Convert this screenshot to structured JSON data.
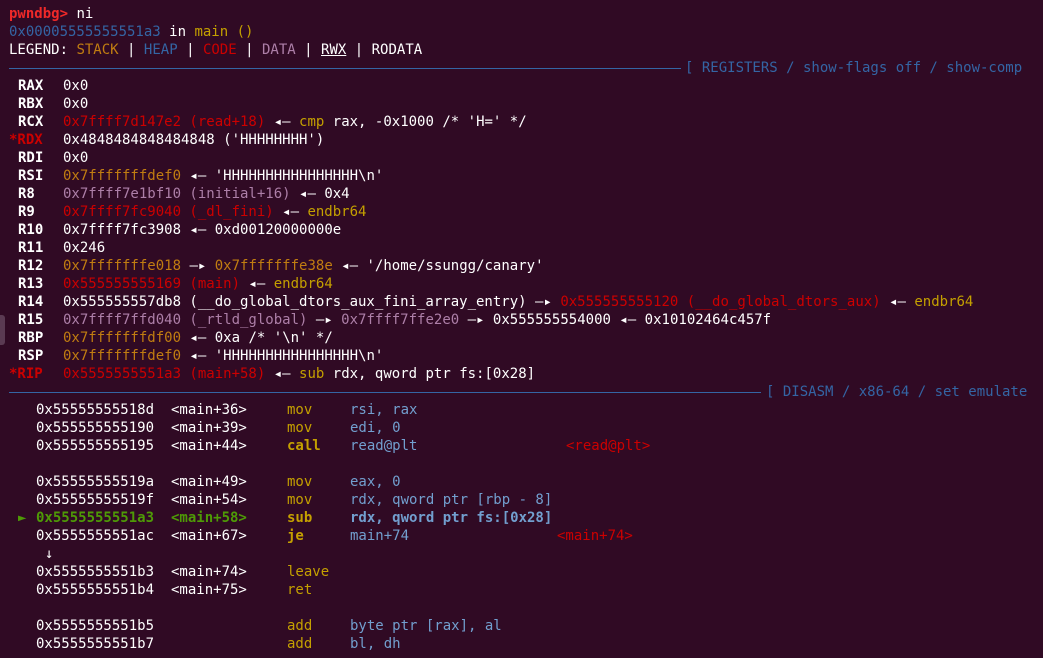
{
  "prompt": {
    "text": "pwndbg>",
    "command": "ni"
  },
  "location": {
    "address": "0x00005555555551a3",
    "in_word": "in",
    "func": "main ()"
  },
  "legend": {
    "label": "LEGEND:",
    "items": [
      "STACK",
      "HEAP",
      "CODE",
      "DATA",
      "RWX",
      "RODATA"
    ],
    "sep": "|"
  },
  "sections": {
    "registers": "[ REGISTERS / show-flags off / show-comp",
    "disasm": "[ DISASM / x86-64 / set emulate"
  },
  "registers": {
    "rax": {
      "name": "RAX",
      "value": "0x0"
    },
    "rbx": {
      "name": "RBX",
      "value": "0x0"
    },
    "rcx": {
      "name": "RCX",
      "value": "0x7ffff7d147e2 (read+18)",
      "arrow": "◂—",
      "mn": "cmp",
      "ops": "rax, -0x1000",
      "comment": "/* 'H=' */"
    },
    "rdx": {
      "name": "*RDX",
      "value": "0x4848484848484848 ('HHHHHHHH')"
    },
    "rdi": {
      "name": "RDI",
      "value": "0x0"
    },
    "rsi": {
      "name": "RSI",
      "value": "0x7fffffffdef0",
      "arrow": "◂—",
      "str": "'HHHHHHHHHHHHHHHH\\n'"
    },
    "r8": {
      "name": "R8",
      "value": "0x7ffff7e1bf10 (initial+16)",
      "arrow": "◂—",
      "tail": "0x4"
    },
    "r9": {
      "name": "R9",
      "value": "0x7ffff7fc9040 (_dl_fini)",
      "arrow": "◂—",
      "mn": "endbr64"
    },
    "r10": {
      "name": "R10",
      "value": "0x7ffff7fc3908",
      "arrow": "◂—",
      "tail": "0xd00120000000e"
    },
    "r11": {
      "name": "R11",
      "value": "0x246"
    },
    "r12": {
      "name": "R12",
      "value": "0x7fffffffe018",
      "arrow2": "—▸",
      "value2": "0x7fffffffe38e",
      "arrow": "◂—",
      "str": "'/home/ssungg/canary'"
    },
    "r13": {
      "name": "R13",
      "value": "0x555555555169 (main)",
      "arrow": "◂—",
      "mn": "endbr64"
    },
    "r14": {
      "name": "R14",
      "value": "0x555555557db8 (__do_global_dtors_aux_fini_array_entry)",
      "arrow2": "—▸",
      "value2": "0x555555555120 (__do_global_dtors_aux)",
      "arrow": "◂—",
      "mn": "endbr64"
    },
    "r15": {
      "name": "R15",
      "value": "0x7ffff7ffd040 (_rtld_global)",
      "arrow2": "—▸",
      "value2": "0x7ffff7ffe2e0",
      "arrow3": "—▸",
      "value3": "0x555555554000",
      "arrow": "◂—",
      "tail": "0x10102464c457f"
    },
    "rbp": {
      "name": "RBP",
      "value": "0x7fffffffdf00",
      "arrow": "◂—",
      "tail": "0xa",
      "comment": "/* '\\n' */"
    },
    "rsp": {
      "name": "RSP",
      "value": "0x7fffffffdef0",
      "arrow": "◂—",
      "str": "'HHHHHHHHHHHHHHHH\\n'"
    },
    "rip": {
      "name": "*RIP",
      "value": "0x5555555551a3 (main+58)",
      "arrow": "◂—",
      "mn": "sub",
      "ops": "rdx, qword ptr fs:[0x28]"
    }
  },
  "disasm": [
    {
      "addr": "0x55555555518d",
      "sym": "<main+36>",
      "mn": "mov",
      "ops": "rsi, rax"
    },
    {
      "addr": "0x555555555190",
      "sym": "<main+39>",
      "mn": "mov",
      "ops": "edi, 0"
    },
    {
      "addr": "0x555555555195",
      "sym": "<main+44>",
      "mn": "call",
      "ops": "read@plt",
      "target": "<read@plt>"
    },
    {
      "addr": "0x55555555519a",
      "sym": "<main+49>",
      "mn": "mov",
      "ops": "eax, 0"
    },
    {
      "addr": "0x55555555519f",
      "sym": "<main+54>",
      "mn": "mov",
      "ops": "rdx, qword ptr [rbp - 8]"
    },
    {
      "addr": "0x5555555551a3",
      "sym": "<main+58>",
      "mn": "sub",
      "ops": "rdx, qword ptr fs:[0x28]",
      "marker": "►"
    },
    {
      "addr": "0x5555555551ac",
      "sym": "<main+67>",
      "mn": "je",
      "ops": "main+74",
      "target": "<main+74>"
    },
    {
      "jump_arrow": "↓"
    },
    {
      "addr": "0x5555555551b3",
      "sym": "<main+74>",
      "mn": "leave",
      "ops": ""
    },
    {
      "addr": "0x5555555551b4",
      "sym": "<main+75>",
      "mn": "ret",
      "ops": ""
    },
    {
      "addr": "0x5555555551b5",
      "sym": "",
      "mn": "add",
      "ops": "byte ptr [rax], al"
    },
    {
      "addr": "0x5555555551b7",
      "sym": "",
      "mn": "add",
      "ops": "bl, dh"
    }
  ]
}
